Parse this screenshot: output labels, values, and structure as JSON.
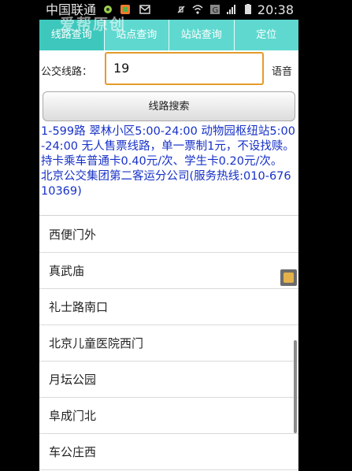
{
  "status_bar": {
    "carrier": "中国联通",
    "time": "20:38"
  },
  "watermark": "爱帮原创",
  "tabs": [
    {
      "label": "线路查询",
      "active": true
    },
    {
      "label": "站点查询",
      "active": false
    },
    {
      "label": "站站查询",
      "active": false
    },
    {
      "label": "定位",
      "active": false
    }
  ],
  "route_input": {
    "label": "公交线路：",
    "value": "19",
    "voice_label": "语音"
  },
  "search_button": "线路搜索",
  "route_info": "1-599路 翠林小区5:00-24:00 动物园枢纽站5:00-24:00 无人售票线路，单一票制1元，不设找赎。持卡乘车普通卡0.40元/次、学生卡0.20元/次。 北京公交集团第二客运分公司(服务热线:010-67610369)",
  "stops": [
    "西便门外",
    "真武庙",
    "礼士路南口",
    "北京儿童医院西门",
    "月坛公园",
    "阜成门北",
    "车公庄西"
  ],
  "colors": {
    "tab_bg": "#5fd9d0",
    "tab_active": "#3ec8bd",
    "info_text": "#1630c8",
    "input_border": "#e59b2b"
  }
}
